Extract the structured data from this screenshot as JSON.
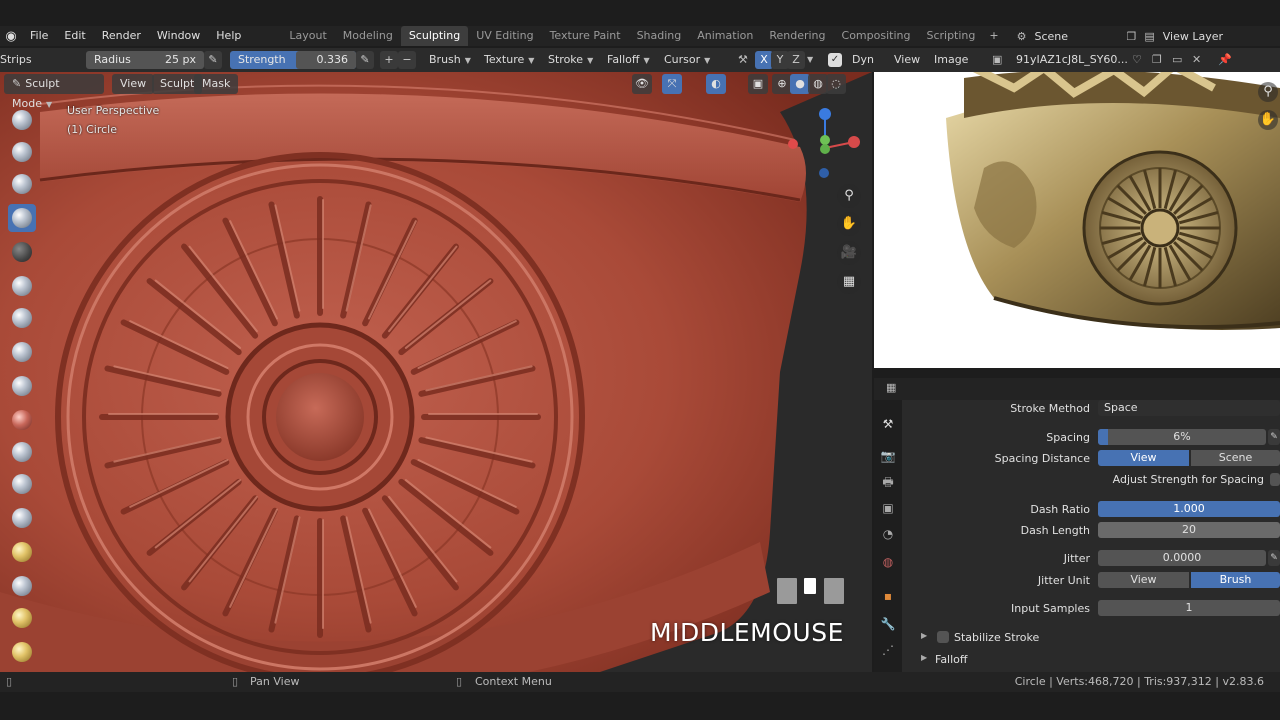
{
  "menu": {
    "file": "File",
    "edit": "Edit",
    "render": "Render",
    "window": "Window",
    "help": "Help"
  },
  "workspaces": [
    "Layout",
    "Modeling",
    "Sculpting",
    "UV Editing",
    "Texture Paint",
    "Shading",
    "Animation",
    "Rendering",
    "Compositing",
    "Scripting"
  ],
  "active_workspace": "Sculpting",
  "scene": {
    "name": "Scene",
    "view_layer": "View Layer"
  },
  "toolsettings": {
    "strips": "Strips",
    "radius_label": "Radius",
    "radius_value": "25 px",
    "strength_label": "Strength",
    "strength_value": "0.336",
    "brush": "Brush",
    "texture": "Texture",
    "stroke": "Stroke",
    "falloff": "Falloff",
    "cursor": "Cursor",
    "x": "X",
    "y": "Y",
    "z": "Z",
    "dyn": "Dyn"
  },
  "viewport": {
    "mode": "Sculpt Mode",
    "view": "View",
    "sculpt": "Sculpt",
    "mask": "Mask",
    "perspective": "User Perspective",
    "object": "(1) Circle",
    "key_overlay": "MIDDLEMOUSE"
  },
  "image_editor": {
    "view": "View",
    "image": "Image",
    "image_name": "91yIAZ1cJ8L_SY60..."
  },
  "properties": {
    "stroke_method_label": "Stroke Method",
    "stroke_method_value": "Space",
    "spacing_label": "Spacing",
    "spacing_value": "6%",
    "spacing_fraction": 0.06,
    "spacing_distance_label": "Spacing Distance",
    "spacing_distance_options": [
      "View",
      "Scene"
    ],
    "adjust_strength_label": "Adjust Strength for Spacing",
    "dash_ratio_label": "Dash Ratio",
    "dash_ratio_value": "1.000",
    "dash_length_label": "Dash Length",
    "dash_length_value": "20",
    "jitter_label": "Jitter",
    "jitter_value": "0.0000",
    "jitter_unit_label": "Jitter Unit",
    "jitter_unit_options": [
      "View",
      "Brush"
    ],
    "input_samples_label": "Input Samples",
    "input_samples_value": "1",
    "stabilize_label": "Stabilize Stroke",
    "falloff_label": "Falloff"
  },
  "status": {
    "pan": "Pan View",
    "context": "Context Menu",
    "stats": "Circle | Verts:468,720 | Tris:937,312 | v2.83.6"
  },
  "colors": {
    "accent": "#4772b3",
    "clay": "#b5503f",
    "header": "#232323"
  }
}
